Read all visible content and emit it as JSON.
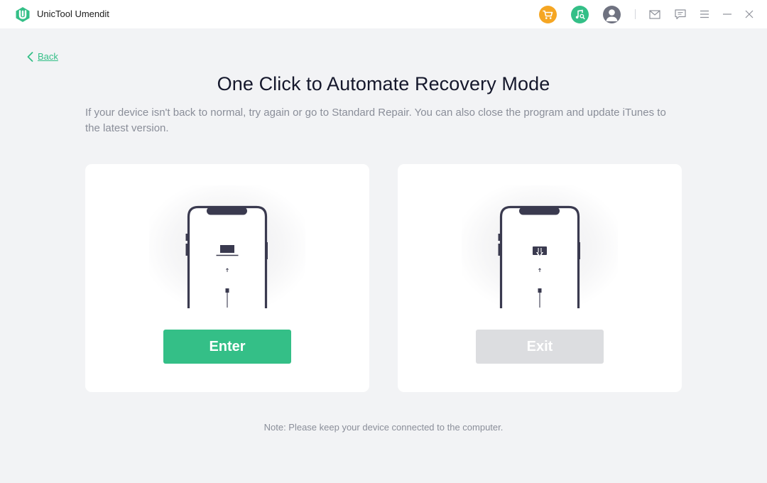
{
  "app": {
    "title": "UnicTool Umendit",
    "accent": "#34bf87"
  },
  "titlebar": {
    "icons": [
      "cart-icon",
      "music-search-icon",
      "user-avatar-icon",
      "mail-icon",
      "chat-icon",
      "menu-icon",
      "minimize-icon",
      "close-icon"
    ],
    "colors": {
      "cart": "#f5a623",
      "music": "#34bf87",
      "avatar": "#6f7280"
    }
  },
  "nav": {
    "back_label": "Back"
  },
  "main": {
    "title": "One Click to Automate Recovery Mode",
    "subtitle": "If your device isn't back to normal, try again or go to Standard Repair. You can also close the program and update iTunes to the latest version.",
    "cards": [
      {
        "id": "enter",
        "button_label": "Enter",
        "button_color": "#34bf87",
        "enabled": true
      },
      {
        "id": "exit",
        "button_label": "Exit",
        "button_color": "#dcdde0",
        "enabled": false
      }
    ],
    "note": "Note: Please keep your device connected to the computer."
  }
}
